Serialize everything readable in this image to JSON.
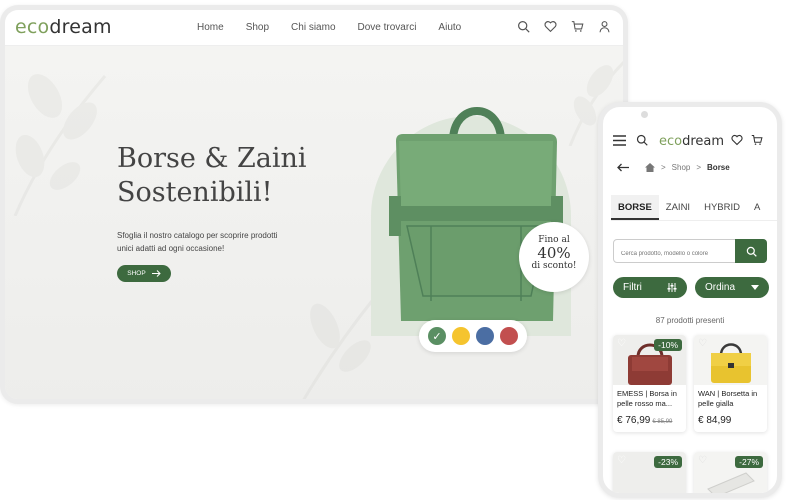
{
  "desktop": {
    "logo": {
      "eco": "eco",
      "dream": "dream"
    },
    "nav": [
      "Home",
      "Shop",
      "Chi siamo",
      "Dove trovarci",
      "Aiuto"
    ],
    "hero": {
      "title_line1": "Borse & Zaini",
      "title_line2": "Sostenibili!",
      "description": "Sfoglia il nostro catalogo per scoprire prodotti unici adatti ad ogni occasione!",
      "shop_button": "SHOP",
      "badge": {
        "line1": "Fino al",
        "line2": "40%",
        "line3": "di sconto!"
      },
      "swatches": [
        {
          "color": "#5a8f63",
          "selected": true
        },
        {
          "color": "#f5c42e",
          "selected": false
        },
        {
          "color": "#4b6ea3",
          "selected": false
        },
        {
          "color": "#c24f4f",
          "selected": false
        }
      ]
    }
  },
  "phone": {
    "logo": {
      "eco": "eco",
      "dream": "dream"
    },
    "breadcrumb": {
      "shop": "Shop",
      "current": "Borse",
      "separator": ">"
    },
    "tabs": [
      "BORSE",
      "ZAINI",
      "HYBRID",
      "A"
    ],
    "search_placeholder": "Cerca prodotto, modello o colore",
    "filters_label": "Filtri",
    "sort_label": "Ordina",
    "count_text": "87 prodotti presenti",
    "products": [
      {
        "discount": "-10%",
        "name": "EMESS | Borsa in pelle rosso ma...",
        "price": "€ 76,99",
        "old_price": "€ 85,99"
      },
      {
        "discount": "",
        "name": "WAN | Borsetta in pelle gialla",
        "price": "€ 84,99",
        "old_price": ""
      },
      {
        "discount": "-23%",
        "name": "",
        "price": "",
        "old_price": ""
      },
      {
        "discount": "-27%",
        "name": "",
        "price": "",
        "old_price": ""
      }
    ]
  },
  "colors": {
    "brand_green": "#3d6a3f",
    "logo_green": "#7fa05c"
  }
}
